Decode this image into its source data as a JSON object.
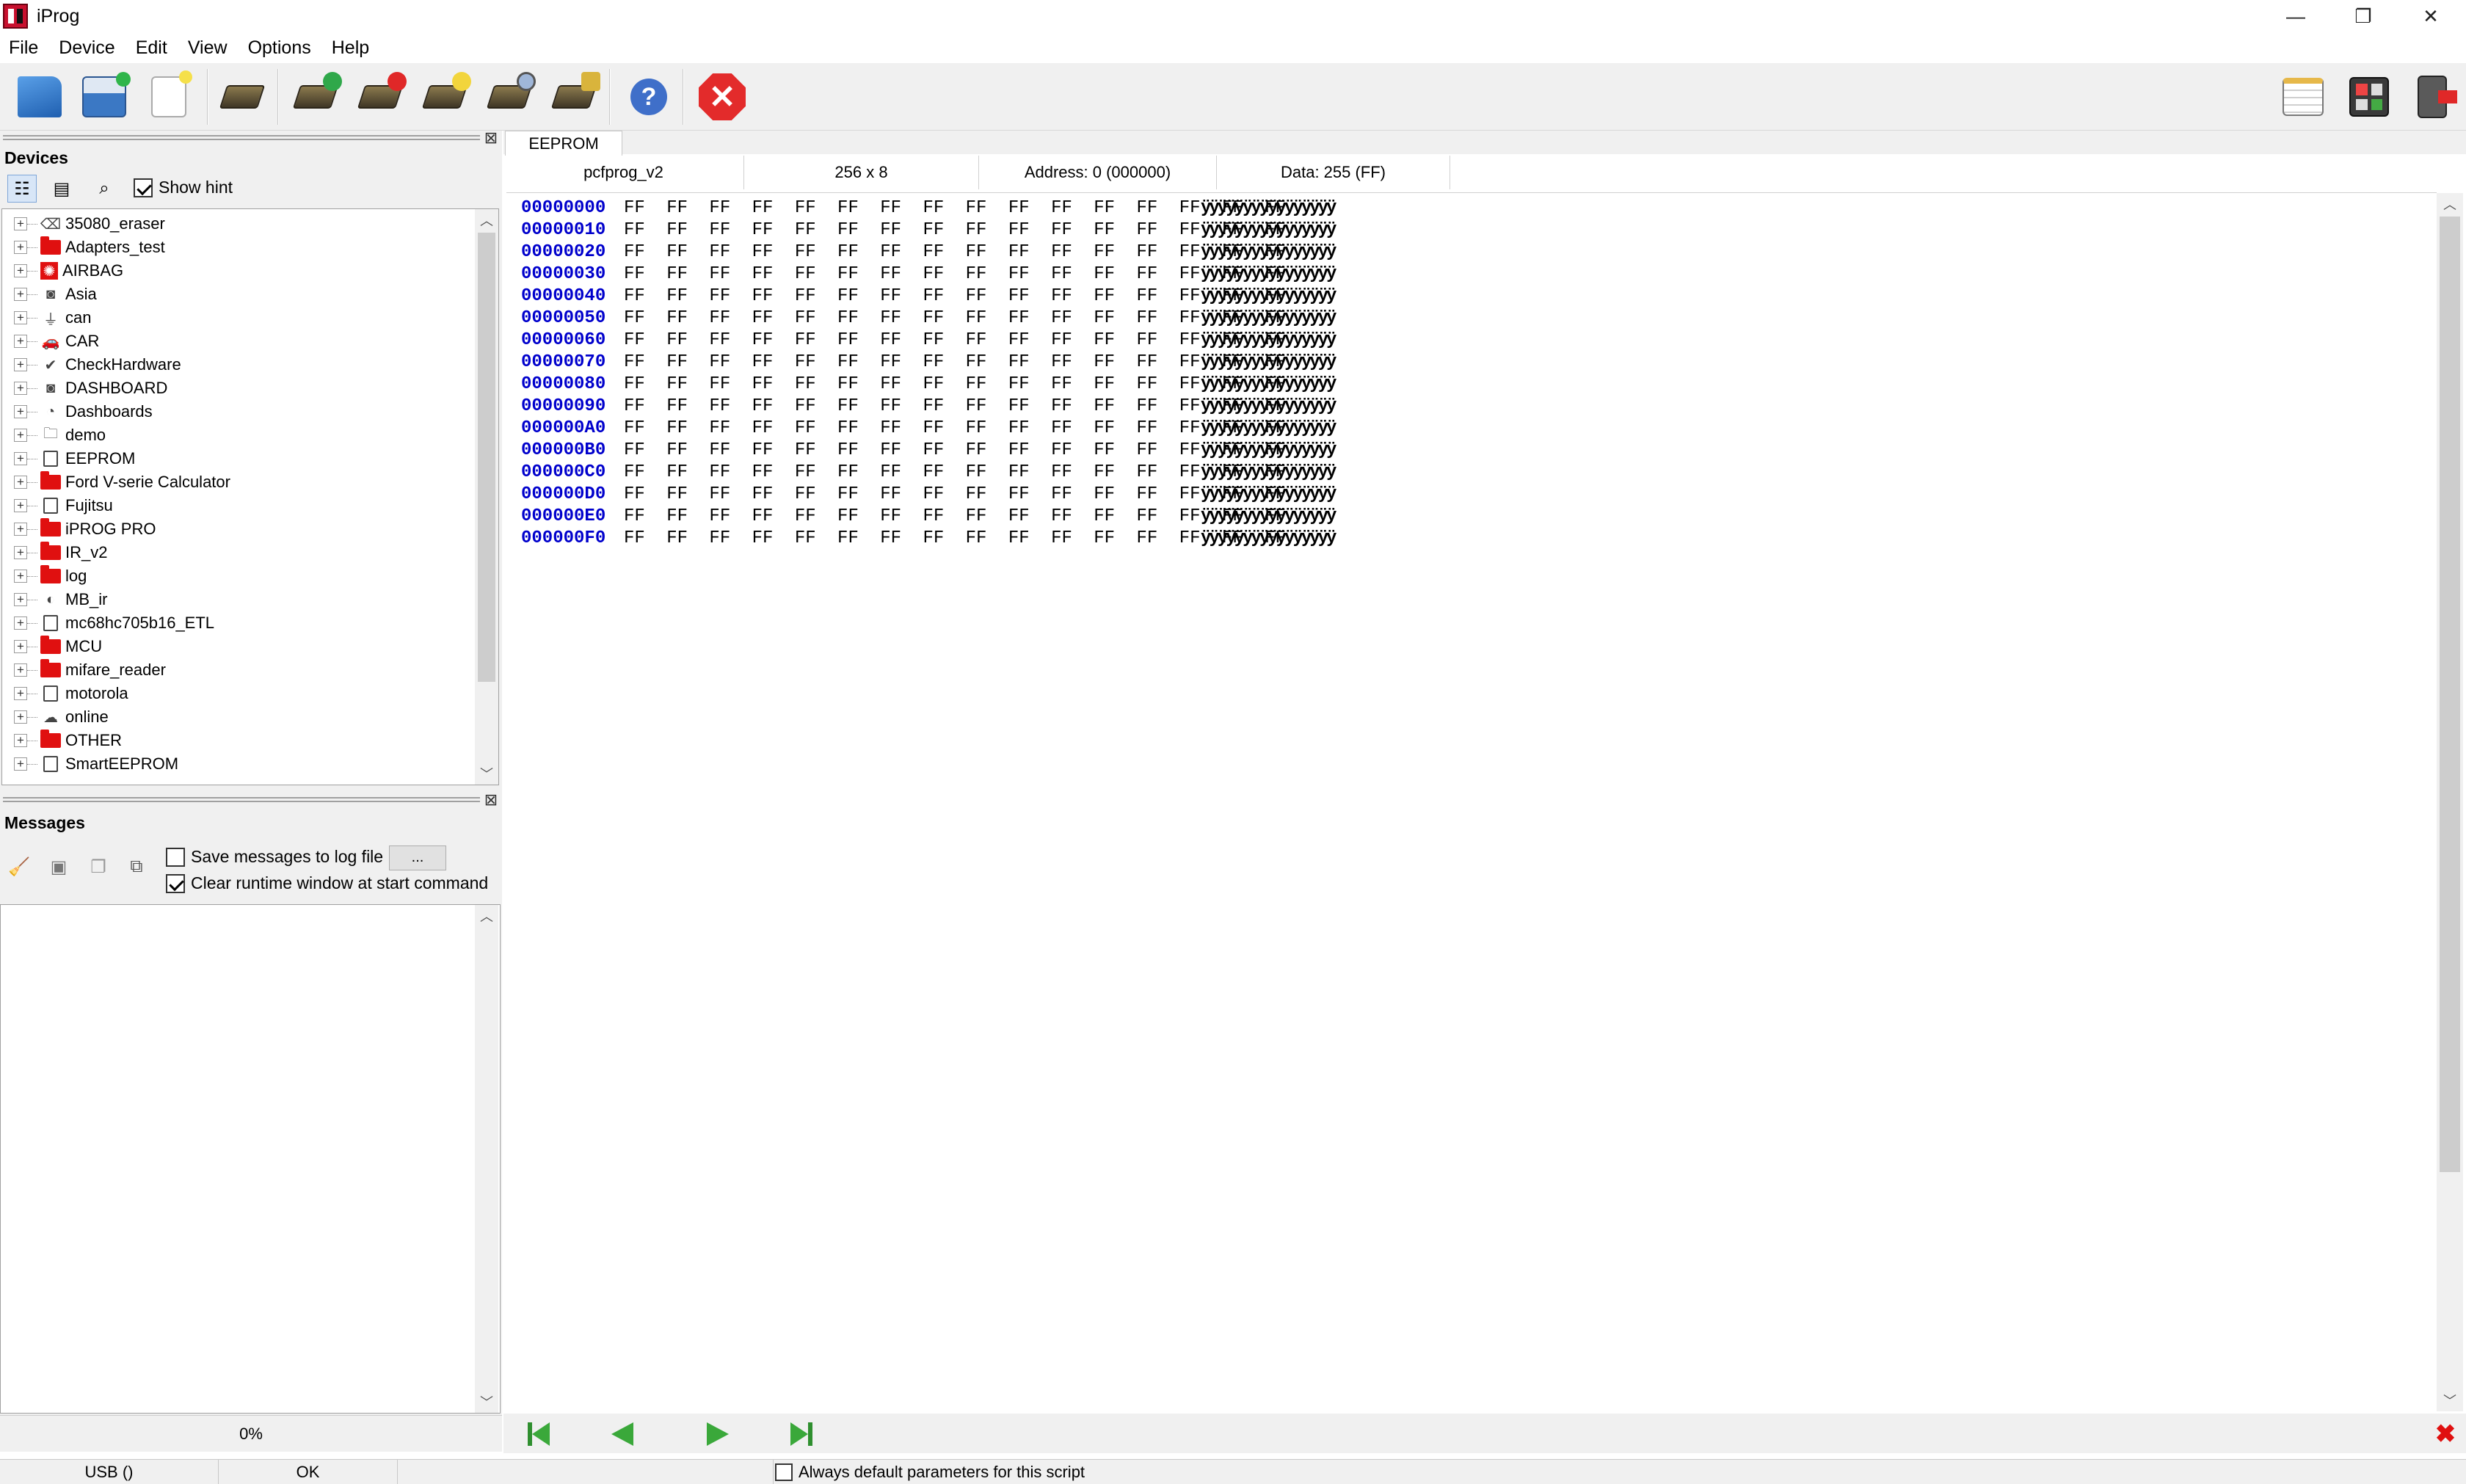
{
  "window": {
    "title": "iProg",
    "minimize_glyph": "—",
    "restore_glyph": "❐",
    "close_glyph": "✕"
  },
  "menu": [
    "File",
    "Device",
    "Edit",
    "View",
    "Options",
    "Help"
  ],
  "toolbar": {
    "left_icons": [
      "open-folder-icon",
      "save-disk-icon",
      "new-file-icon",
      "chip-icon",
      "chip-read-icon",
      "chip-write-icon",
      "chip-erase-icon",
      "chip-search-icon",
      "chip-settings-icon",
      "help-search-icon",
      "stop-icon"
    ],
    "right_icons": [
      "notepad-icon",
      "calculator-icon",
      "exit-door-icon"
    ]
  },
  "devices_panel": {
    "title": "Devices",
    "show_hint_label": "Show hint",
    "show_hint_checked": true,
    "items": [
      {
        "label": "35080_eraser",
        "icon": "eraser-icon"
      },
      {
        "label": "Adapters_test",
        "icon": "folder-icon"
      },
      {
        "label": "AIRBAG",
        "icon": "airbag-icon"
      },
      {
        "label": "Asia",
        "icon": "dashboard-icon"
      },
      {
        "label": "can",
        "icon": "plug-icon"
      },
      {
        "label": "CAR",
        "icon": "car-icon"
      },
      {
        "label": "CheckHardware",
        "icon": "check-icon"
      },
      {
        "label": "DASHBOARD",
        "icon": "dashboard-icon"
      },
      {
        "label": "Dashboards",
        "icon": "gauge-icon"
      },
      {
        "label": "demo",
        "icon": "folder-open-icon"
      },
      {
        "label": "EEPROM",
        "icon": "chip-icon"
      },
      {
        "label": "Ford V-serie Calculator",
        "icon": "folder-icon"
      },
      {
        "label": "Fujitsu",
        "icon": "chip-icon"
      },
      {
        "label": "iPROG PRO",
        "icon": "folder-icon"
      },
      {
        "label": "IR_v2",
        "icon": "folder-icon"
      },
      {
        "label": "log",
        "icon": "folder-icon"
      },
      {
        "label": "MB_ir",
        "icon": "ir-icon"
      },
      {
        "label": "mc68hc705b16_ETL",
        "icon": "chip-icon"
      },
      {
        "label": "MCU",
        "icon": "folder-icon"
      },
      {
        "label": "mifare_reader",
        "icon": "folder-icon"
      },
      {
        "label": "motorola",
        "icon": "chip-icon"
      },
      {
        "label": "online",
        "icon": "cloud-icon"
      },
      {
        "label": "OTHER",
        "icon": "folder-icon"
      },
      {
        "label": "SmartEEPROM",
        "icon": "chip-icon"
      }
    ]
  },
  "messages_panel": {
    "title": "Messages",
    "save_to_log_label": "Save messages to log file",
    "save_to_log_checked": false,
    "browse_label": "...",
    "clear_runtime_label": "Clear runtime window at start command",
    "clear_runtime_checked": true,
    "progress_text": "0%"
  },
  "editor": {
    "tab": "EEPROM",
    "info": {
      "device": "pcfprog_v2",
      "size": "256 x 8",
      "address": "Address: 0 (000000)",
      "data": "Data: 255 (FF)"
    },
    "hex_rows": [
      {
        "addr": "00000000",
        "bytes": "FF FF FF FF FF FF FF FF FF FF FF FF FF FF FF FF",
        "ascii": "ÿÿÿÿÿÿÿÿÿÿÿÿÿÿÿÿ"
      },
      {
        "addr": "00000010",
        "bytes": "FF FF FF FF FF FF FF FF FF FF FF FF FF FF FF FF",
        "ascii": "ÿÿÿÿÿÿÿÿÿÿÿÿÿÿÿÿ"
      },
      {
        "addr": "00000020",
        "bytes": "FF FF FF FF FF FF FF FF FF FF FF FF FF FF FF FF",
        "ascii": "ÿÿÿÿÿÿÿÿÿÿÿÿÿÿÿÿ"
      },
      {
        "addr": "00000030",
        "bytes": "FF FF FF FF FF FF FF FF FF FF FF FF FF FF FF FF",
        "ascii": "ÿÿÿÿÿÿÿÿÿÿÿÿÿÿÿÿ"
      },
      {
        "addr": "00000040",
        "bytes": "FF FF FF FF FF FF FF FF FF FF FF FF FF FF FF FF",
        "ascii": "ÿÿÿÿÿÿÿÿÿÿÿÿÿÿÿÿ"
      },
      {
        "addr": "00000050",
        "bytes": "FF FF FF FF FF FF FF FF FF FF FF FF FF FF FF FF",
        "ascii": "ÿÿÿÿÿÿÿÿÿÿÿÿÿÿÿÿ"
      },
      {
        "addr": "00000060",
        "bytes": "FF FF FF FF FF FF FF FF FF FF FF FF FF FF FF FF",
        "ascii": "ÿÿÿÿÿÿÿÿÿÿÿÿÿÿÿÿ"
      },
      {
        "addr": "00000070",
        "bytes": "FF FF FF FF FF FF FF FF FF FF FF FF FF FF FF FF",
        "ascii": "ÿÿÿÿÿÿÿÿÿÿÿÿÿÿÿÿ"
      },
      {
        "addr": "00000080",
        "bytes": "FF FF FF FF FF FF FF FF FF FF FF FF FF FF FF FF",
        "ascii": "ÿÿÿÿÿÿÿÿÿÿÿÿÿÿÿÿ"
      },
      {
        "addr": "00000090",
        "bytes": "FF FF FF FF FF FF FF FF FF FF FF FF FF FF FF FF",
        "ascii": "ÿÿÿÿÿÿÿÿÿÿÿÿÿÿÿÿ"
      },
      {
        "addr": "000000A0",
        "bytes": "FF FF FF FF FF FF FF FF FF FF FF FF FF FF FF FF",
        "ascii": "ÿÿÿÿÿÿÿÿÿÿÿÿÿÿÿÿ"
      },
      {
        "addr": "000000B0",
        "bytes": "FF FF FF FF FF FF FF FF FF FF FF FF FF FF FF FF",
        "ascii": "ÿÿÿÿÿÿÿÿÿÿÿÿÿÿÿÿ"
      },
      {
        "addr": "000000C0",
        "bytes": "FF FF FF FF FF FF FF FF FF FF FF FF FF FF FF FF",
        "ascii": "ÿÿÿÿÿÿÿÿÿÿÿÿÿÿÿÿ"
      },
      {
        "addr": "000000D0",
        "bytes": "FF FF FF FF FF FF FF FF FF FF FF FF FF FF FF FF",
        "ascii": "ÿÿÿÿÿÿÿÿÿÿÿÿÿÿÿÿ"
      },
      {
        "addr": "000000E0",
        "bytes": "FF FF FF FF FF FF FF FF FF FF FF FF FF FF FF FF",
        "ascii": "ÿÿÿÿÿÿÿÿÿÿÿÿÿÿÿÿ"
      },
      {
        "addr": "000000F0",
        "bytes": "FF FF FF FF FF FF FF FF FF FF FF FF FF FF FF FF",
        "ascii": "ÿÿÿÿÿÿÿÿÿÿÿÿÿÿÿÿ"
      }
    ]
  },
  "navigation": {
    "icons": [
      "first-page-icon",
      "previous-page-icon",
      "next-page-icon",
      "last-page-icon"
    ],
    "close_glyph": "✖"
  },
  "statusbar": {
    "port": "USB ()",
    "state": "OK",
    "default_params_label": "Always default parameters for this script",
    "default_params_checked": false
  },
  "colors": {
    "accent_red": "#e01010",
    "hex_address_blue": "#0000cc",
    "nav_green": "#2f8f2f",
    "panel_gray": "#f0f0f0"
  }
}
